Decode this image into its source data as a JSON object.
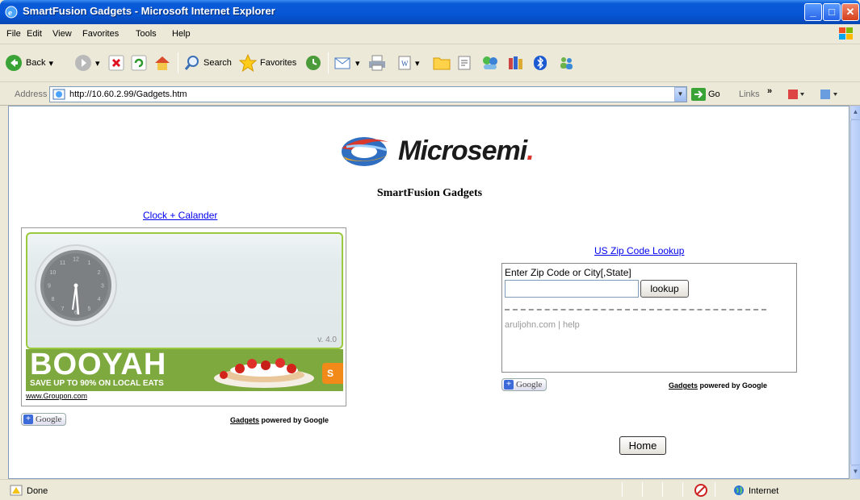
{
  "window": {
    "title": "SmartFusion Gadgets - Microsoft Internet Explorer",
    "minimize": "_",
    "maximize": "□",
    "close": "✕"
  },
  "menu": {
    "items": [
      "File",
      "Edit",
      "View",
      "Favorites",
      "Tools",
      "Help"
    ]
  },
  "toolbar": {
    "back_label": "Back",
    "search_label": "Search",
    "favorites_label": "Favorites"
  },
  "address": {
    "label": "Address",
    "url": "http://10.60.2.99/Gadgets.htm",
    "go_label": "Go",
    "links_label": "Links",
    "links_more": "»"
  },
  "page": {
    "logo_text": "Microsemi",
    "logo_mark": ".",
    "title": "SmartFusion Gadgets",
    "clock_link": "Clock + Calander",
    "clock_version": "v. 4.0",
    "ad_headline": "BOOYAH",
    "ad_subline": "SAVE UP TO 90% ON LOCAL EATS",
    "ad_cta": "S",
    "ad_url": "www.Groupon.com",
    "google_button": "Google",
    "gadgets_link": "Gadgets",
    "powered_by": " powered by Google",
    "zip_link": "US Zip Code Lookup",
    "zip_label": "Enter Zip Code or City[,State]",
    "zip_button": "lookup",
    "zip_input_value": "",
    "zip_credit_site": "aruljohn.com",
    "zip_credit_sep": " | ",
    "zip_credit_help": "help",
    "home_button": "Home",
    "clock_numbers": [
      "12",
      "1",
      "2",
      "3",
      "4",
      "5",
      "6",
      "7",
      "8",
      "9",
      "10",
      "11"
    ]
  },
  "status": {
    "text": "Done",
    "zone": "Internet"
  },
  "colors": {
    "titlebar": "#0656d6",
    "link": "#0000ee",
    "clock_border": "#9bc93e",
    "ad_background": "#7da93e"
  }
}
